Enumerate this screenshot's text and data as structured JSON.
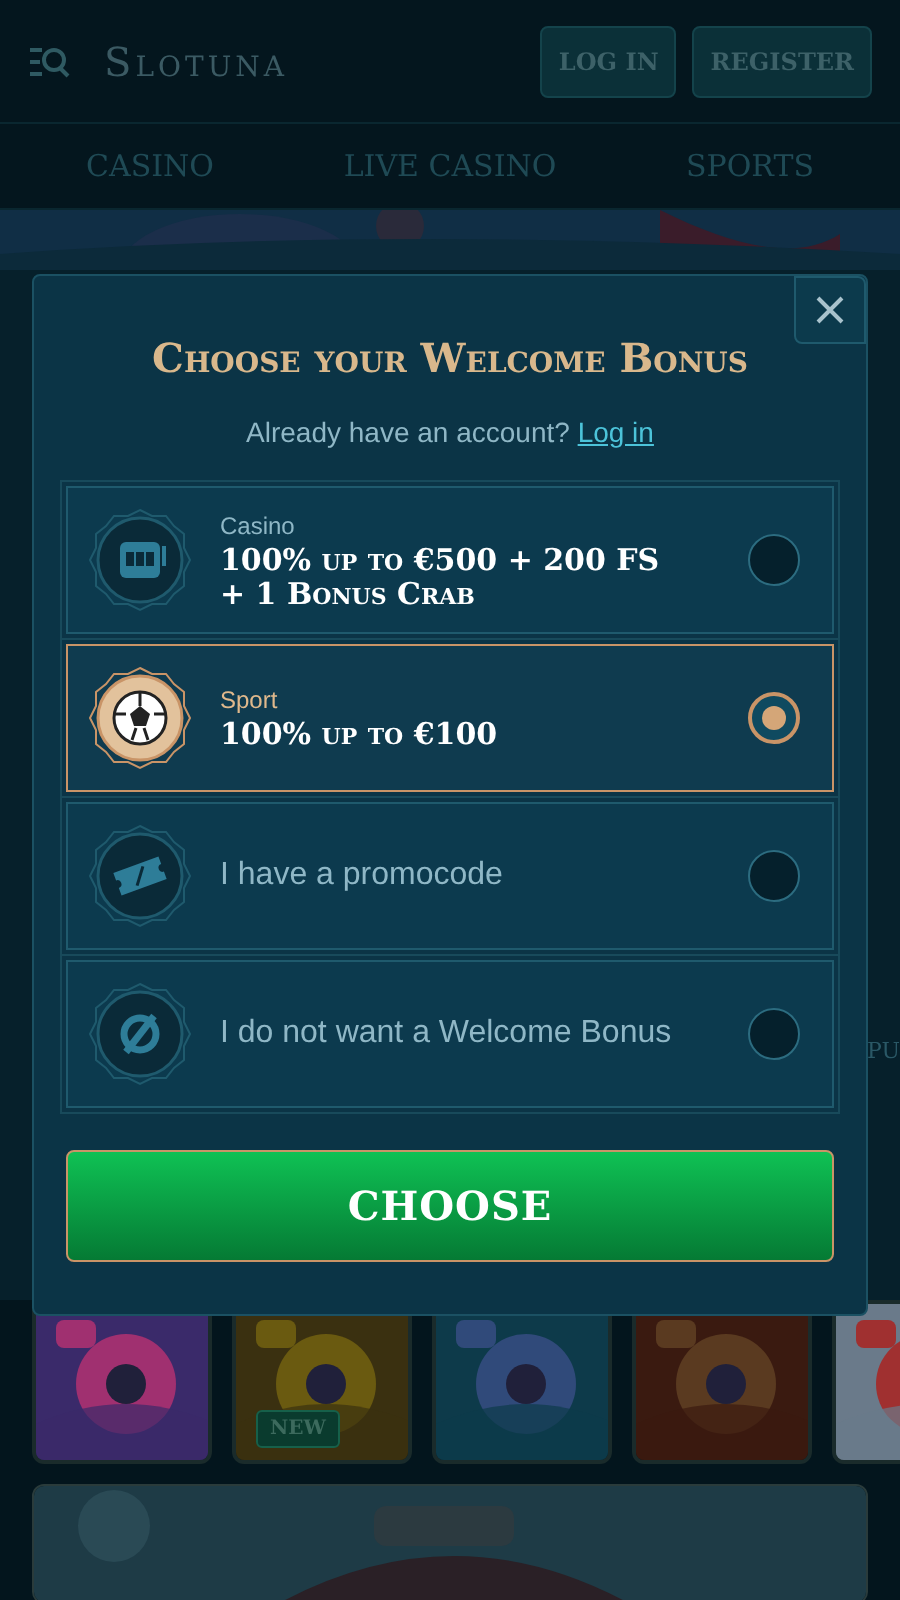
{
  "header": {
    "logo": "Slotuna",
    "buttons": [
      {
        "label": "LOG IN"
      },
      {
        "label": "REGISTER"
      }
    ]
  },
  "nav": [
    {
      "label": "CASINO"
    },
    {
      "label": "LIVE CASINO"
    },
    {
      "label": "SPORTS"
    }
  ],
  "side_text": "PU",
  "games": [
    {
      "kind": "picture"
    },
    {
      "kind": "picture",
      "badge": "NEW"
    },
    {
      "kind": "picture"
    },
    {
      "kind": "picture"
    },
    {
      "kind": "picture"
    }
  ],
  "modal": {
    "title": "Choose your Welcome Bonus",
    "prompt": "Already have an account?",
    "login_link": "Log in",
    "options": [
      {
        "kind": "casino",
        "category": "Casino",
        "offer": "100% up to €500 + 200 FS + 1 Bonus Crab",
        "selected": false
      },
      {
        "kind": "sport",
        "category": "Sport",
        "offer": "100% up to €100",
        "selected": true
      },
      {
        "kind": "promocode",
        "label": "I have a promocode",
        "selected": false
      },
      {
        "kind": "none",
        "label": "I do not want a Welcome Bonus",
        "selected": false
      }
    ],
    "button": "CHOOSE"
  }
}
